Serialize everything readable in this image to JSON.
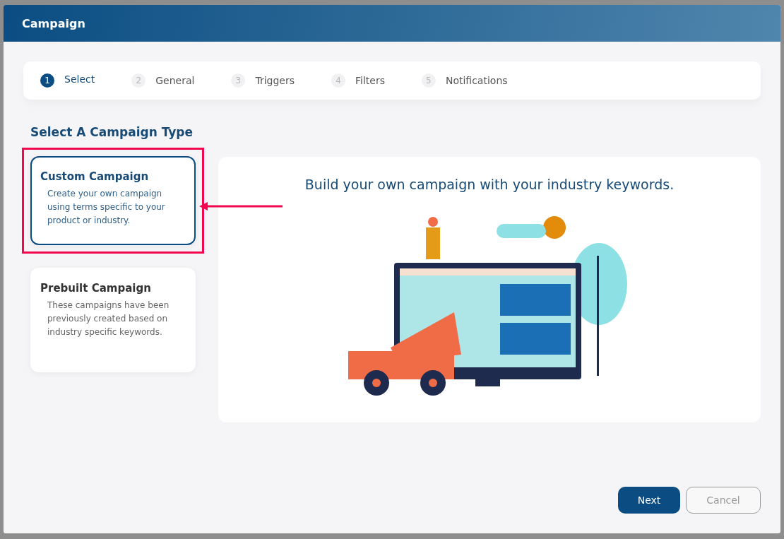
{
  "window": {
    "title": "Campaign"
  },
  "steps": [
    {
      "number": "1",
      "label": "Select",
      "selected": true
    },
    {
      "number": "2",
      "label": "General",
      "selected": false
    },
    {
      "number": "3",
      "label": "Triggers",
      "selected": false
    },
    {
      "number": "4",
      "label": "Filters",
      "selected": false
    },
    {
      "number": "5",
      "label": "Notifications",
      "selected": false
    }
  ],
  "heading": "Select A Campaign Type",
  "cards": [
    {
      "title": "Custom Campaign",
      "description": "Create your own campaign using terms specific to your product or industry.",
      "selected": true,
      "highlighted": true
    },
    {
      "title": "Prebuilt Campaign",
      "description": "These campaigns have been previously created based on industry specific keywords.",
      "selected": false,
      "highlighted": false
    }
  ],
  "preview": {
    "caption": "Build your own campaign with your industry keywords."
  },
  "buttons": [
    {
      "label": "Next",
      "kind": "primary"
    },
    {
      "label": "Cancel",
      "kind": "secondary"
    }
  ]
}
